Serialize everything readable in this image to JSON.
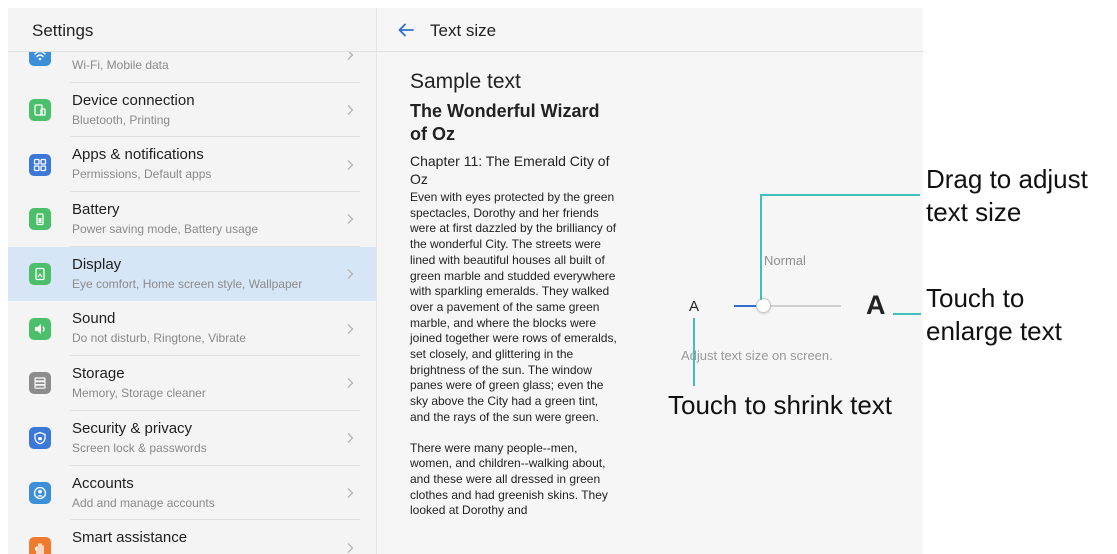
{
  "settings": {
    "title": "Settings",
    "items": [
      {
        "title": "",
        "subtitle": "Wi-Fi, Mobile data",
        "icon": "wifi-icon",
        "color": "#3b8fd9"
      },
      {
        "title": "Device connection",
        "subtitle": "Bluetooth, Printing",
        "icon": "device-connection-icon",
        "color": "#4cbf6b"
      },
      {
        "title": "Apps & notifications",
        "subtitle": "Permissions, Default apps",
        "icon": "apps-icon",
        "color": "#3b78d8"
      },
      {
        "title": "Battery",
        "subtitle": "Power saving mode, Battery usage",
        "icon": "battery-icon",
        "color": "#4cbf6b"
      },
      {
        "title": "Display",
        "subtitle": "Eye comfort, Home screen style, Wallpaper",
        "icon": "display-icon",
        "color": "#4cbf6b"
      },
      {
        "title": "Sound",
        "subtitle": "Do not disturb, Ringtone, Vibrate",
        "icon": "sound-icon",
        "color": "#4cbf6b"
      },
      {
        "title": "Storage",
        "subtitle": "Memory, Storage cleaner",
        "icon": "storage-icon",
        "color": "#8c8c8c"
      },
      {
        "title": "Security & privacy",
        "subtitle": "Screen lock & passwords",
        "icon": "shield-icon",
        "color": "#3b78d8"
      },
      {
        "title": "Accounts",
        "subtitle": "Add and manage accounts",
        "icon": "account-icon",
        "color": "#3b8fd9"
      },
      {
        "title": "Smart assistance",
        "subtitle": "",
        "icon": "hand-icon",
        "color": "#f07a2e"
      }
    ]
  },
  "text_size": {
    "title": "Text size",
    "sample_heading": "Sample text",
    "book_title": "The Wonderful Wizard of Oz",
    "chapter": "Chapter 11: The Emerald City of Oz",
    "paragraph1": "Even with eyes protected by the green spectacles, Dorothy and her friends were at first dazzled by the brilliancy of the wonderful City. The streets were lined with beautiful houses all built of green marble and studded everywhere with sparkling emeralds. They walked over a pavement of the same green marble, and where the blocks were joined together were rows of emeralds, set closely, and glittering in the brightness of the sun. The window panes were of green glass; even the sky above the City had a green tint, and the rays of the sun were green.",
    "paragraph2": "There were many people--men, women, and children--walking about, and these were all dressed in green clothes and had greenish skins. They looked at Dorothy and",
    "level_label": "Normal",
    "small_a": "A",
    "large_a": "A",
    "hint": "Adjust text size on screen.",
    "slider_fraction": 0.28,
    "accent_color": "#2f6fd0"
  },
  "annotations": {
    "drag_line1": "Drag to adjust",
    "drag_line2": "text size",
    "enlarge_line1": "Touch to",
    "enlarge_line2": "enlarge text",
    "shrink": "Touch to shrink text",
    "line_color": "#40c0b8"
  }
}
